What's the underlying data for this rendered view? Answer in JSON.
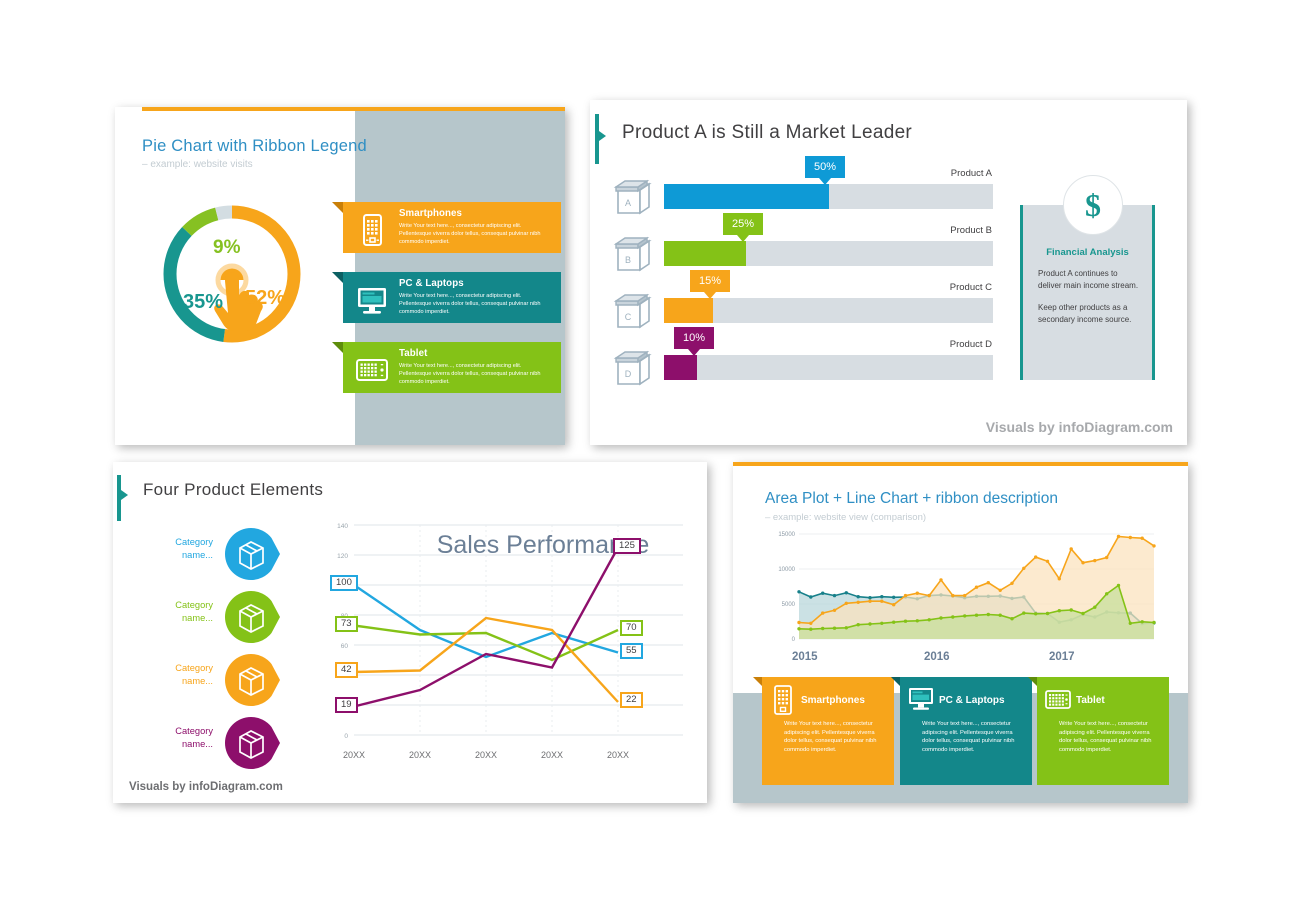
{
  "slide1": {
    "title": "Pie Chart with Ribbon Legend",
    "subtitle": "– example: website visits",
    "donut": {
      "labels": [
        "52%",
        "35%",
        "9%"
      ],
      "colors": [
        "#f7a51b",
        "#18968f",
        "#86c122",
        "#d3dde2"
      ]
    },
    "ribbons": [
      {
        "title": "Smartphones",
        "text": "Write Your text here..., consectetur adipiscing elit. Pellentesque viverra dolor tellus, consequat pulvinar nibh commodo imperdiet.",
        "icon": "smartphone-icon",
        "color": "#f7a51b"
      },
      {
        "title": "PC & Laptops",
        "text": "Write Your text here..., consectetur adipiscing elit. Pellentesque viverra dolor tellus, consequat pulvinar nibh commodo imperdiet.",
        "icon": "desktop-computer-icon",
        "color": "#13878a"
      },
      {
        "title": "Tablet",
        "text": "Write Your text here..., consectetur adipiscing elit. Pellentesque viverra dolor tellus, consequat pulvinar nibh commodo imperdiet.",
        "icon": "tablet-icon",
        "color": "#84c217"
      }
    ]
  },
  "slide2": {
    "title": "Product A is Still a Market Leader",
    "footer": "Visuals by infoDiagram.com",
    "rows": [
      {
        "box": "A",
        "name": "Product A",
        "value": "50%",
        "pct": 50,
        "color": "#0e9ad6"
      },
      {
        "box": "B",
        "name": "Product B",
        "value": "25%",
        "pct": 25,
        "color": "#84c217"
      },
      {
        "box": "C",
        "name": "Product C",
        "value": "15%",
        "pct": 15,
        "color": "#f7a51b"
      },
      {
        "box": "D",
        "name": "Product D",
        "value": "10%",
        "pct": 10,
        "color": "#8d0f6b"
      }
    ],
    "panel": {
      "icon": "$",
      "title": "Financial Analysis",
      "paragraph1": "Product A continues to deliver main income stream.",
      "paragraph2": "Keep other products as a secondary income source."
    }
  },
  "slide3": {
    "title": "Four Product Elements",
    "footer": "Visuals by infoDiagram.com",
    "categories": [
      {
        "label": "Category name...",
        "color": "#22a7e0"
      },
      {
        "label": "Category name...",
        "color": "#84c217"
      },
      {
        "label": "Category name...",
        "color": "#f7a51b"
      },
      {
        "label": "Category name...",
        "color": "#8d0f6b"
      }
    ],
    "chart_data": {
      "type": "line",
      "title": "Sales Performance",
      "xlabel": "",
      "ylabel": "",
      "ylim": [
        0,
        140
      ],
      "yticks": [
        0,
        20,
        40,
        60,
        80,
        100,
        120,
        140
      ],
      "categories": [
        "20XX",
        "20XX",
        "20XX",
        "20XX",
        "20XX"
      ],
      "grid": true,
      "legend": "none",
      "series": [
        {
          "name": "Blue",
          "color": "#22a7e0",
          "values": [
            100,
            70,
            52,
            68,
            55
          ],
          "start_label": "100",
          "end_label": "55"
        },
        {
          "name": "Green",
          "color": "#84c217",
          "values": [
            73,
            67,
            68,
            50,
            70
          ],
          "start_label": "73",
          "end_label": "70"
        },
        {
          "name": "Orange",
          "color": "#f7a51b",
          "values": [
            42,
            43,
            78,
            70,
            22
          ],
          "start_label": "42",
          "end_label": "22"
        },
        {
          "name": "Purple",
          "color": "#8d0f6b",
          "values": [
            19,
            30,
            54,
            45,
            125
          ],
          "start_label": "19",
          "end_label": "125"
        }
      ]
    }
  },
  "slide4": {
    "title": "Area Plot + Line Chart + ribbon description",
    "subtitle": "– example: website view (comparison)",
    "chart_data": {
      "type": "area",
      "title": "",
      "ylim": [
        0,
        15000
      ],
      "yticks": [
        0,
        5000,
        10000,
        15000
      ],
      "xlabels": [
        "2015",
        "2016",
        "2017"
      ],
      "grid": true,
      "legend": "none",
      "series": [
        {
          "name": "Smartphones",
          "color": "#f7a51b",
          "fill": "#fbe2bd",
          "values": [
            2350,
            2250,
            3700,
            4100,
            5100,
            5250,
            5400,
            5400,
            4900,
            6200,
            6550,
            6200,
            8450,
            6200,
            6200,
            7400,
            8050,
            6950,
            7950,
            10100,
            11700,
            11100,
            8600,
            12850,
            10900,
            11200,
            11650,
            14650,
            14500,
            14400,
            13300
          ]
        },
        {
          "name": "PC & Laptops",
          "color": "#17808a",
          "fill": "#b7d6da",
          "values": [
            6750,
            6000,
            6550,
            6200,
            6600,
            6050,
            5900,
            6050,
            5950,
            6000,
            5750,
            6200,
            6300,
            6150,
            5900,
            6100,
            6100,
            6150,
            5800,
            6000,
            3700,
            3650,
            2400,
            2750,
            3500,
            3150,
            3850,
            3750,
            3700,
            2200,
            2300
          ]
        },
        {
          "name": "Tablet",
          "color": "#84c217",
          "fill": "#c6df9a",
          "values": [
            1450,
            1400,
            1500,
            1550,
            1600,
            2050,
            2150,
            2250,
            2400,
            2550,
            2600,
            2750,
            3000,
            3150,
            3300,
            3400,
            3500,
            3400,
            2900,
            3700,
            3600,
            3650,
            4050,
            4150,
            3650,
            4550,
            6450,
            7650,
            2250,
            2450,
            2350
          ]
        }
      ]
    },
    "ribbons": [
      {
        "title": "Smartphones",
        "text": "Write Your text here..., consectetur adipiscing elit. Pellentesque viverra dolor tellus, consequat pulvinar nibh commodo imperdiet.",
        "icon": "smartphone-icon",
        "color": "#f7a51b"
      },
      {
        "title": "PC & Laptops",
        "text": "Write Your text here..., consectetur adipiscing elit. Pellentesque viverra dolor tellus, consequat pulvinar nibh commodo imperdiet.",
        "icon": "desktop-computer-icon",
        "color": "#13878a"
      },
      {
        "title": "Tablet",
        "text": "Write Your text here..., consectetur adipiscing elit. Pellentesque viverra dolor tellus, consequat pulvinar nibh commodo imperdiet.",
        "icon": "tablet-icon",
        "color": "#84c217"
      }
    ]
  }
}
